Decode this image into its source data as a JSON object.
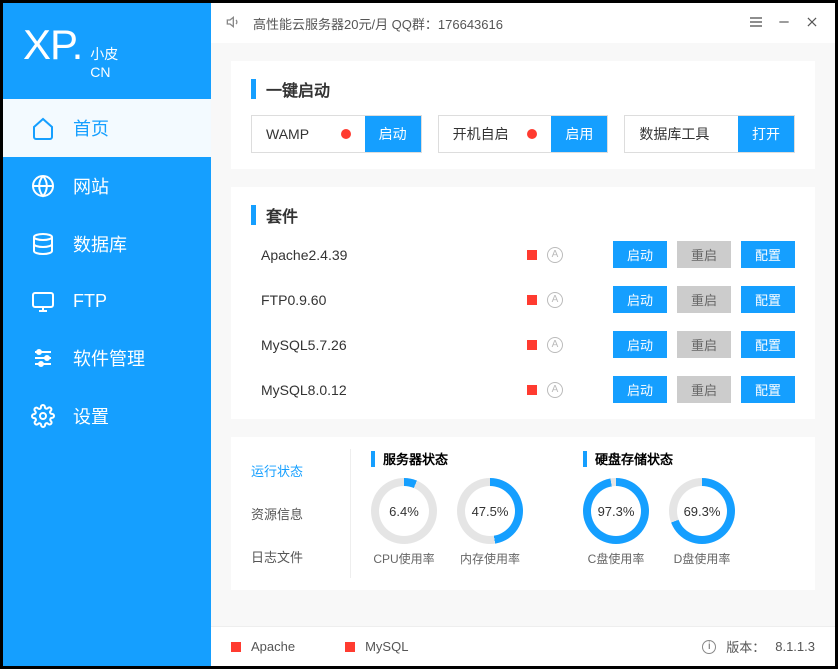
{
  "logo": {
    "main": "XP.",
    "sub1": "小皮",
    "sub2": "CN"
  },
  "nav": [
    {
      "label": "首页",
      "icon": "home"
    },
    {
      "label": "网站",
      "icon": "globe"
    },
    {
      "label": "数据库",
      "icon": "database"
    },
    {
      "label": "FTP",
      "icon": "monitor"
    },
    {
      "label": "软件管理",
      "icon": "sliders"
    },
    {
      "label": "设置",
      "icon": "gear"
    }
  ],
  "titlebar": {
    "announce": "高性能云服务器20元/月  QQ群：176643616"
  },
  "quickstart": {
    "title": "一键启动",
    "items": [
      {
        "label": "WAMP",
        "dot": true,
        "btn": "启动"
      },
      {
        "label": "开机自启",
        "dot": true,
        "btn": "启用"
      },
      {
        "label": "数据库工具",
        "dot": false,
        "btn": "打开"
      }
    ]
  },
  "suite": {
    "title": "套件",
    "rows": [
      {
        "name": "Apache2.4.39",
        "b1": "启动",
        "b2": "重启",
        "b3": "配置"
      },
      {
        "name": "FTP0.9.60",
        "b1": "启动",
        "b2": "重启",
        "b3": "配置"
      },
      {
        "name": "MySQL5.7.26",
        "b1": "启动",
        "b2": "重启",
        "b3": "配置"
      },
      {
        "name": "MySQL8.0.12",
        "b1": "启动",
        "b2": "重启",
        "b3": "配置"
      }
    ]
  },
  "status": {
    "tabs": [
      "运行状态",
      "资源信息",
      "日志文件"
    ],
    "server_title": "服务器状态",
    "disk_title": "硬盘存储状态",
    "gauges_server": [
      {
        "pct": "6.4%",
        "val": 6.4,
        "label": "CPU使用率"
      },
      {
        "pct": "47.5%",
        "val": 47.5,
        "label": "内存使用率"
      }
    ],
    "gauges_disk": [
      {
        "pct": "97.3%",
        "val": 97.3,
        "label": "C盘使用率"
      },
      {
        "pct": "69.3%",
        "val": 69.3,
        "label": "D盘使用率"
      }
    ]
  },
  "footer": {
    "s1": "Apache",
    "s2": "MySQL",
    "version_label": "版本：",
    "version": "8.1.1.3"
  }
}
